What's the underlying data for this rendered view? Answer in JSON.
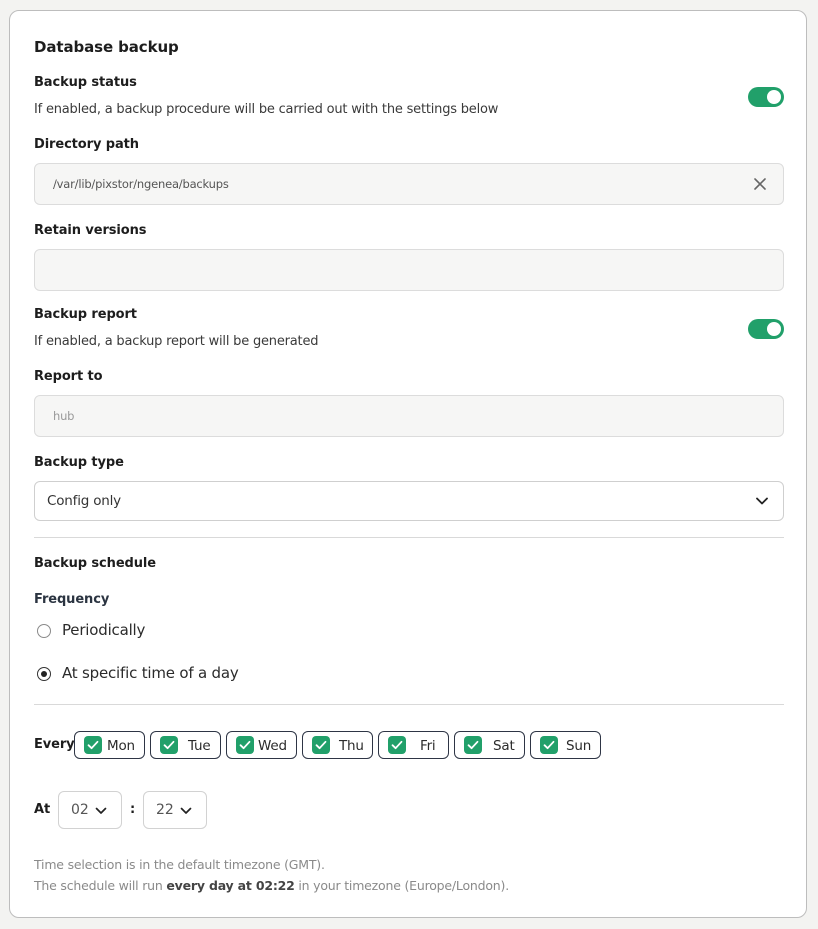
{
  "section": {
    "title": "Database backup"
  },
  "backup_status": {
    "label": "Backup status",
    "description": "If enabled, a backup procedure will be carried out with the settings below",
    "enabled": true
  },
  "directory_path": {
    "label": "Directory path",
    "value": "/var/lib/pixstor/ngenea/backups",
    "clear_icon": "close-icon"
  },
  "retain_versions": {
    "label": "Retain versions",
    "value": ""
  },
  "backup_report": {
    "label": "Backup report",
    "description": "If enabled, a backup report will be generated",
    "enabled": true
  },
  "report_to": {
    "label": "Report to",
    "placeholder": "hub",
    "value": ""
  },
  "backup_type": {
    "label": "Backup type",
    "selected": "Config only",
    "icon": "chevron-down-icon"
  },
  "schedule": {
    "title": "Backup schedule",
    "frequency_label": "Frequency",
    "options": [
      {
        "label": "Periodically",
        "checked": false
      },
      {
        "label": "At specific time of a day",
        "checked": true
      }
    ],
    "every_label": "Every",
    "days": [
      {
        "label": "Mon",
        "checked": true
      },
      {
        "label": "Tue",
        "checked": true
      },
      {
        "label": "Wed",
        "checked": true
      },
      {
        "label": "Thu",
        "checked": true
      },
      {
        "label": "Fri",
        "checked": true
      },
      {
        "label": "Sat",
        "checked": true
      },
      {
        "label": "Sun",
        "checked": true
      }
    ],
    "at_label": "At",
    "hour": "02",
    "separator": ":",
    "minute": "22",
    "note_line1": "Time selection is in the default timezone (GMT).",
    "note_line2_prefix": "The schedule will run ",
    "note_line2_bold": "every day at 02:22",
    "note_line2_suffix": " in your timezone (Europe/London)."
  },
  "colors": {
    "accent": "#21a06a",
    "border_dark": "#2e3545",
    "text_muted": "#8a8a8a"
  }
}
